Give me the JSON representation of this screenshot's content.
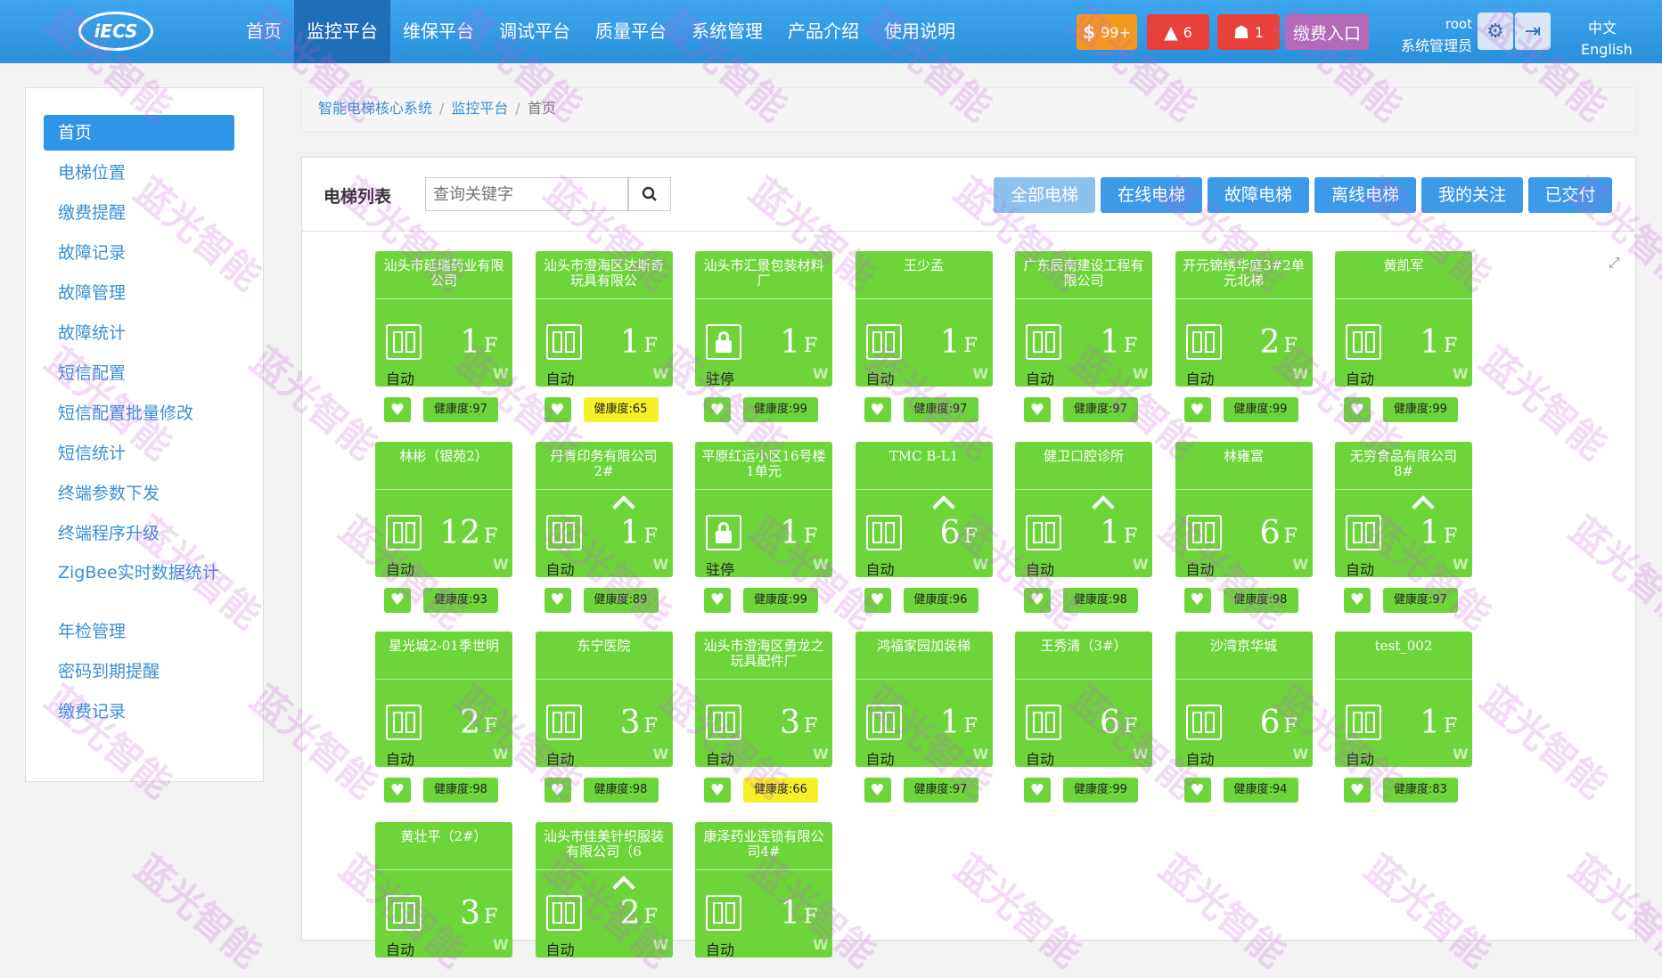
{
  "header": {
    "logo": "iECS",
    "nav": [
      "首页",
      "监控平台",
      "维保平台",
      "调试平台",
      "质量平台",
      "系统管理",
      "产品介绍",
      "使用说明"
    ],
    "badges": {
      "fee_count": "99+",
      "alarm_count": "6",
      "person_count": "1",
      "pay_entry": "缴费入口"
    },
    "user": "root",
    "role": "系统管理员",
    "lang_zh": "中文",
    "lang_en": "English"
  },
  "sidebar": [
    "首页",
    "电梯位置",
    "缴费提醒",
    "故障记录",
    "故障管理",
    "故障统计",
    "短信配置",
    "短信配置批量修改",
    "短信统计",
    "终端参数下发",
    "终端程序升级",
    "ZigBee实时数据统计",
    "年检管理",
    "密码到期提醒",
    "缴费记录"
  ],
  "breadcrumb": [
    "智能电梯核心系统",
    "监控平台",
    "首页"
  ],
  "panel": {
    "title": "电梯列表",
    "search_placeholder": "查询关键字",
    "filters": [
      "全部电梯",
      "在线电梯",
      "故障电梯",
      "离线电梯",
      "我的关注",
      "已交付"
    ]
  },
  "health_prefix": "健康度:",
  "elevators": [
    {
      "name": "汕头市延瑞药业有限公司",
      "floor": "1",
      "mode": "自动",
      "health": "97",
      "status": "normal",
      "icon": "door",
      "up": false
    },
    {
      "name": "汕头市澄海区达斯奇玩具有限公",
      "floor": "1",
      "mode": "自动",
      "health": "65",
      "status": "warn",
      "icon": "door",
      "up": false
    },
    {
      "name": "汕头市汇景包装材料厂",
      "floor": "1",
      "mode": "驻停",
      "health": "99",
      "status": "normal",
      "icon": "lock",
      "up": false
    },
    {
      "name": "王少孟",
      "floor": "1",
      "mode": "自动",
      "health": "97",
      "status": "normal",
      "icon": "door",
      "up": false
    },
    {
      "name": "广东辰南建设工程有限公司",
      "floor": "1",
      "mode": "自动",
      "health": "97",
      "status": "normal",
      "icon": "door",
      "up": false
    },
    {
      "name": "开元锦绣华庭3#2单元北梯",
      "floor": "2",
      "mode": "自动",
      "health": "99",
      "status": "normal",
      "icon": "door",
      "up": false
    },
    {
      "name": "黄凯军",
      "floor": "1",
      "mode": "自动",
      "health": "99",
      "status": "normal",
      "icon": "door",
      "up": false
    },
    {
      "name": "林彬（银苑2）",
      "floor": "12",
      "mode": "自动",
      "health": "93",
      "status": "normal",
      "icon": "door",
      "up": false
    },
    {
      "name": "丹青印务有限公司 2#",
      "floor": "1",
      "mode": "自动",
      "health": "89",
      "status": "normal",
      "icon": "door",
      "up": true
    },
    {
      "name": "平原红运小区16号楼1单元",
      "floor": "1",
      "mode": "驻停",
      "health": "99",
      "status": "normal",
      "icon": "lock",
      "up": false
    },
    {
      "name": "TMC B-L1",
      "floor": "6",
      "mode": "自动",
      "health": "96",
      "status": "normal",
      "icon": "door",
      "up": true
    },
    {
      "name": "健卫口腔诊所",
      "floor": "1",
      "mode": "自动",
      "health": "98",
      "status": "normal",
      "icon": "door",
      "up": true
    },
    {
      "name": "林雍富",
      "floor": "6",
      "mode": "自动",
      "health": "98",
      "status": "normal",
      "icon": "door",
      "up": false
    },
    {
      "name": "无穷食品有限公司8#",
      "floor": "1",
      "mode": "自动",
      "health": "97",
      "status": "normal",
      "icon": "door",
      "up": true
    },
    {
      "name": "星光城2-01季世明",
      "floor": "2",
      "mode": "自动",
      "health": "98",
      "status": "normal",
      "icon": "door",
      "up": false
    },
    {
      "name": "东宁医院",
      "floor": "3",
      "mode": "自动",
      "health": "98",
      "status": "normal",
      "icon": "door",
      "up": false
    },
    {
      "name": "汕头市澄海区勇龙之玩具配件厂",
      "floor": "3",
      "mode": "自动",
      "health": "66",
      "status": "warn",
      "icon": "door",
      "up": false
    },
    {
      "name": "鸿福家园加装梯",
      "floor": "1",
      "mode": "自动",
      "health": "97",
      "status": "normal",
      "icon": "door",
      "up": false
    },
    {
      "name": "王秀清（3#）",
      "floor": "6",
      "mode": "自动",
      "health": "99",
      "status": "normal",
      "icon": "door",
      "up": false
    },
    {
      "name": "沙湾京华城",
      "floor": "6",
      "mode": "自动",
      "health": "94",
      "status": "normal",
      "icon": "door",
      "up": false
    },
    {
      "name": "test_002",
      "floor": "1",
      "mode": "自动",
      "health": "83",
      "status": "normal",
      "icon": "door",
      "up": false
    },
    {
      "name": "黄壮平（2#）",
      "floor": "3",
      "mode": "自动",
      "health": "",
      "status": "normal",
      "icon": "door",
      "up": false
    },
    {
      "name": "汕头市佳美针织服装有限公司（6",
      "floor": "2",
      "mode": "自动",
      "health": "",
      "status": "normal",
      "icon": "door",
      "up": true
    },
    {
      "name": "康泽药业连锁有限公司4#",
      "floor": "1",
      "mode": "自动",
      "health": "",
      "status": "normal",
      "icon": "door",
      "up": false
    }
  ],
  "watermark": "蓝光智能",
  "colors": {
    "brand": "#2a8fdc",
    "card_green": "#6dd53a",
    "warn_yellow": "#f5f027"
  }
}
